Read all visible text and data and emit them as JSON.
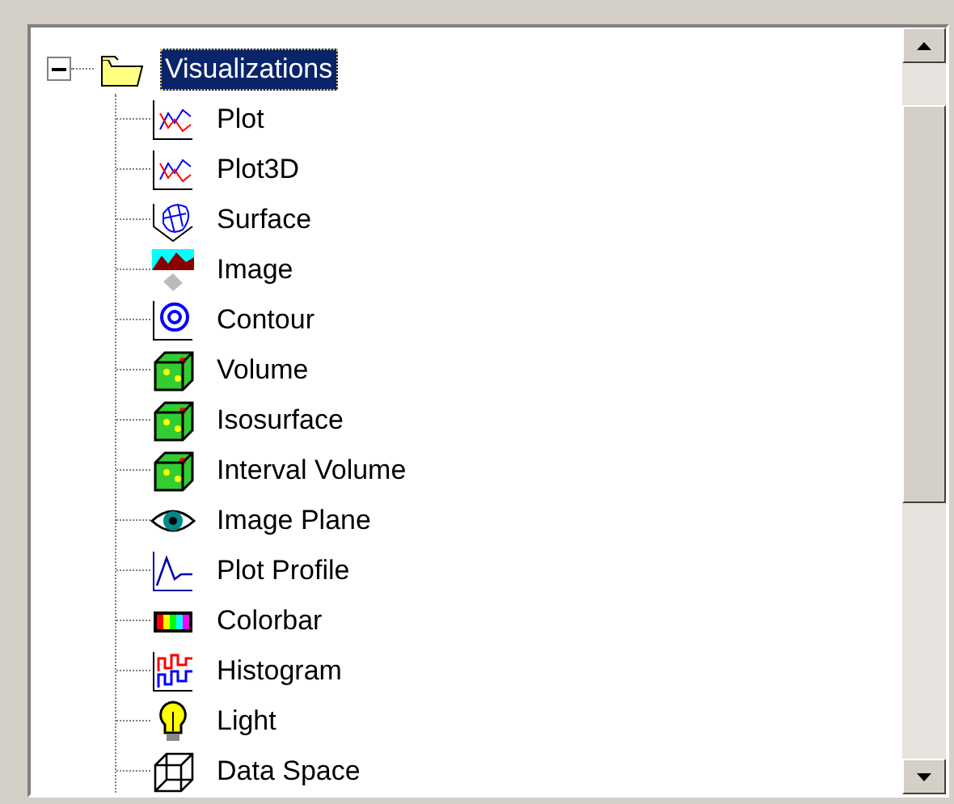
{
  "tree": {
    "label": "Visualizations",
    "expanded": true,
    "selected": true,
    "children": [
      {
        "label": "Plot",
        "kind": "plot",
        "selected": false
      },
      {
        "label": "Plot3D",
        "kind": "plot",
        "selected": false
      },
      {
        "label": "Surface",
        "kind": "surface",
        "selected": false
      },
      {
        "label": "Image",
        "kind": "image",
        "selected": false
      },
      {
        "label": "Contour",
        "kind": "contour",
        "selected": false
      },
      {
        "label": "Volume",
        "kind": "volume",
        "selected": false
      },
      {
        "label": "Isosurface",
        "kind": "volume",
        "selected": false
      },
      {
        "label": "Interval Volume",
        "kind": "volume",
        "selected": false
      },
      {
        "label": "Image Plane",
        "kind": "eye",
        "selected": false
      },
      {
        "label": "Plot Profile",
        "kind": "profile",
        "selected": false
      },
      {
        "label": "Colorbar",
        "kind": "colorbar",
        "selected": false
      },
      {
        "label": "Histogram",
        "kind": "histogram",
        "selected": false
      },
      {
        "label": "Light",
        "kind": "light",
        "selected": false
      },
      {
        "label": "Data Space",
        "kind": "dataspace",
        "selected": false
      }
    ]
  }
}
